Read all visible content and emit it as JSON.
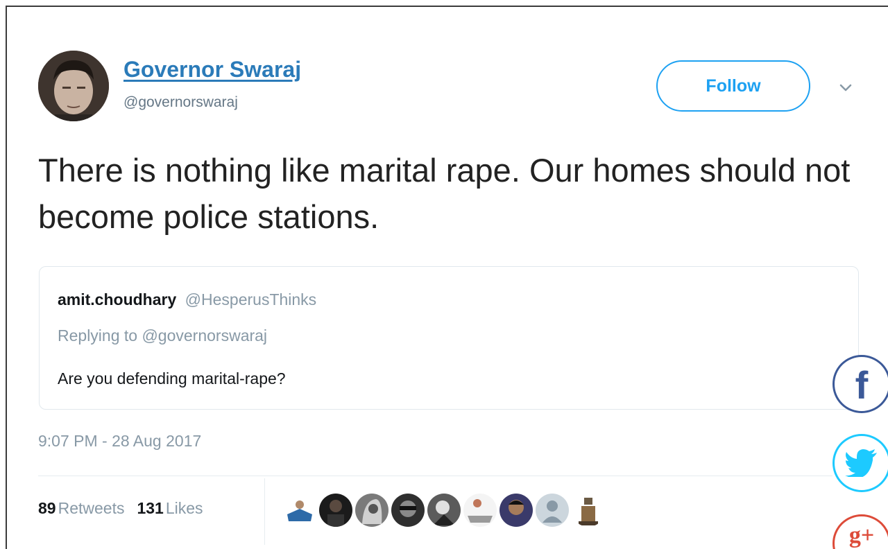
{
  "tweet": {
    "author_name": "Governor Swaraj",
    "author_handle": "@governorswaraj",
    "follow_label": "Follow",
    "text": "There is nothing like marital rape. Our homes should not become police stations.",
    "timestamp": "9:07 PM - 28 Aug 2017"
  },
  "quoted_tweet": {
    "author_name": "amit.choudhary",
    "author_handle": "@HesperusThinks",
    "replying_to": "Replying to @governorswaraj",
    "text": "Are you defending marital-rape?"
  },
  "stats": {
    "retweets_count": "89",
    "retweets_label": "Retweets",
    "likes_count": "131",
    "likes_label": "Likes"
  },
  "liker_avatars": [
    "avatar-1",
    "avatar-2",
    "avatar-3",
    "avatar-4",
    "avatar-5",
    "avatar-6",
    "avatar-7",
    "avatar-8",
    "avatar-9"
  ],
  "share_buttons": [
    {
      "name": "facebook",
      "icon": "facebook-icon"
    },
    {
      "name": "twitter",
      "icon": "twitter-icon"
    },
    {
      "name": "google-plus",
      "icon": "google-plus-icon"
    }
  ],
  "colors": {
    "link_blue": "#2b7bb9",
    "follow_blue": "#1da1f2",
    "muted_gray": "#8899a6",
    "facebook": "#3b5998",
    "twitter": "#1dcaff",
    "google_plus": "#dd4b39"
  }
}
